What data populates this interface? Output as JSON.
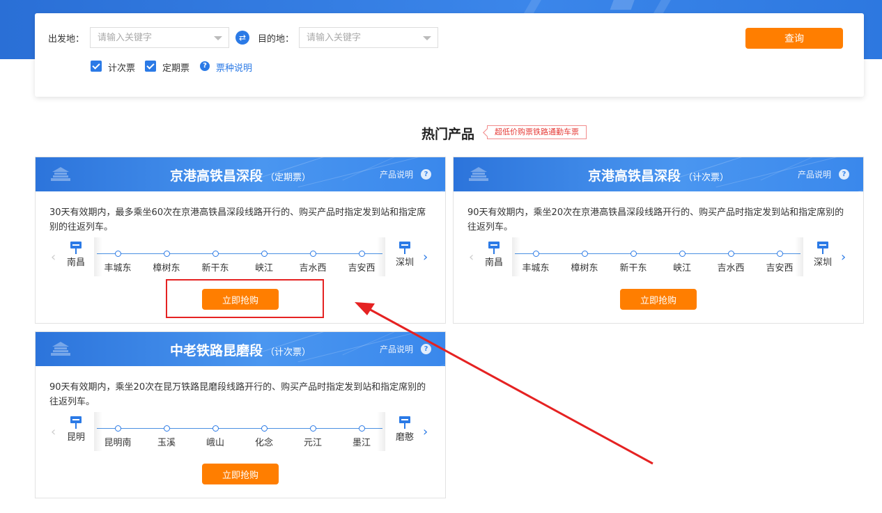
{
  "search": {
    "from_label": "出发地：",
    "from_placeholder": "请输入关键字",
    "to_label": "目的地：",
    "to_placeholder": "请输入关键字",
    "query_label": "查询",
    "checkbox_count": {
      "label": "计次票",
      "checked": true
    },
    "checkbox_period": {
      "label": "定期票",
      "checked": true
    },
    "ticket_info_link": "票种说明"
  },
  "hot": {
    "title": "热门产品",
    "badge": "超低价购票铁路通勤车票"
  },
  "colors": {
    "primary": "#2b7ae6",
    "accent": "#ff7e00",
    "highlight": "#e52222"
  },
  "cards": [
    {
      "title": "京港高铁昌深段",
      "type": "（定期票）",
      "info_label": "产品说明",
      "desc": "30天有效期内，最多乘坐60次在京港高铁昌深段线路开行的、购买产品时指定发到站和指定席别的往返列车。",
      "start": "南昌",
      "end": "深圳",
      "stops": [
        "丰城东",
        "樟树东",
        "新干东",
        "峡江",
        "吉水西",
        "吉安西"
      ],
      "buy_label": "立即抢购"
    },
    {
      "title": "京港高铁昌深段",
      "type": "（计次票）",
      "info_label": "产品说明",
      "desc": "90天有效期内，乘坐20次在京港高铁昌深段线路开行的、购买产品时指定发到站和指定席别的往返列车。",
      "start": "南昌",
      "end": "深圳",
      "stops": [
        "丰城东",
        "樟树东",
        "新干东",
        "峡江",
        "吉水西",
        "吉安西"
      ],
      "buy_label": "立即抢购"
    },
    {
      "title": "中老铁路昆磨段",
      "type": "（计次票）",
      "info_label": "产品说明",
      "desc": "90天有效期内，乘坐20次在昆万铁路昆磨段线路开行的、购买产品时指定发到站和指定席别的往返列车。",
      "start": "昆明",
      "end": "磨憨",
      "stops": [
        "昆明南",
        "玉溪",
        "峨山",
        "化念",
        "元江",
        "墨江"
      ],
      "buy_label": "立即抢购"
    }
  ]
}
